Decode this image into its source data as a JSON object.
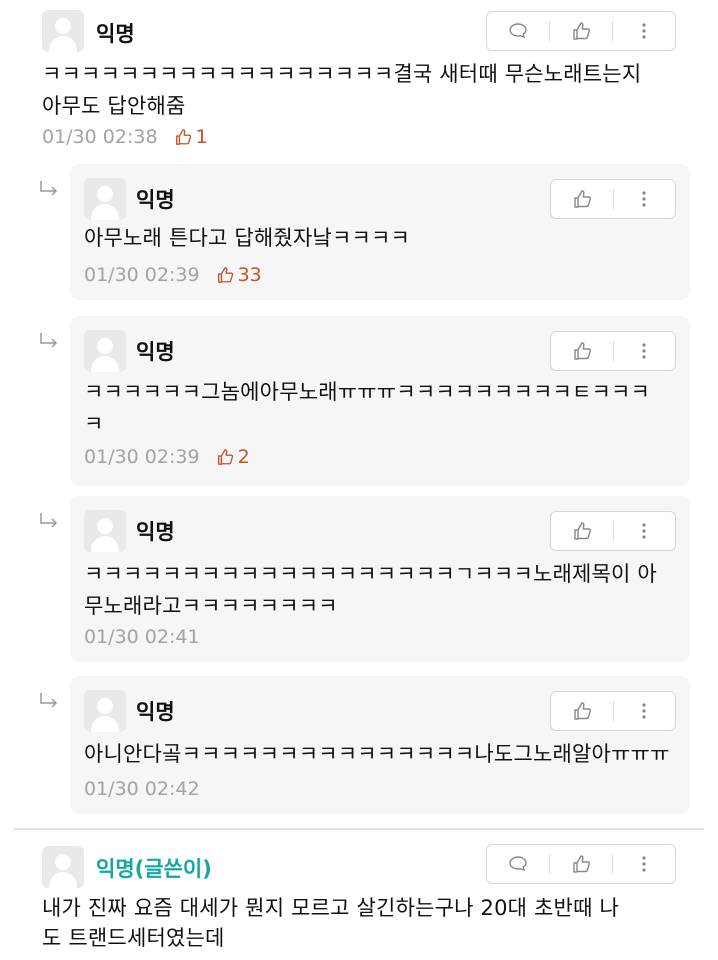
{
  "comments": [
    {
      "author": "익명",
      "text_lines": [
        "ㅋㅋㅋㅋㅋㅋㅋㅋㅋㅋㅋㅋㅋㅋㅋㅋㅋㅋ결국 새터때 무슨노래트는지",
        "아무도 답안해줌"
      ],
      "time": "01/30 02:38",
      "likes": "1"
    }
  ],
  "replies": [
    {
      "author": "익명",
      "text_lines": [
        "아무노래 튼다고 답해줬자낰ㅋㅋㅋㅋ"
      ],
      "time": "01/30 02:39",
      "likes": "33"
    },
    {
      "author": "익명",
      "text_lines": [
        "ㅋㅋㅋㅋㅋㅋ그놈에아무노래ㅠㅠㅠㅋㅋㅋㅋㅋㅋㅋㅋㅋㅌㅋㅋㅋ",
        "ㅋ"
      ],
      "time": "01/30 02:39",
      "likes": "2"
    },
    {
      "author": "익명",
      "text_lines": [
        "ㅋㅋㅋㅋㅋㅋㅋㅋㅋㅋㅋㅋㅋㅋㅋㅋㅋㅋㅋㄱㅋㅋㅋ노래제목이 아",
        "무노래라고ㅋㅋㅋㅋㅋㅋㅋㅋ"
      ],
      "time": "01/30 02:41",
      "likes": ""
    },
    {
      "author": "익명",
      "text_lines": [
        "아니안다곸ㅋㅋㅋㅋㅋㅋㅋㅋㅋㅋㅋㅋㅋㅋㅋ나도그노래알아ㅠㅠㅠ"
      ],
      "time": "01/30 02:42",
      "likes": ""
    }
  ],
  "last_comment": {
    "author": "익명(글쓴이)",
    "text_lines": [
      "내가 진짜 요즘 대세가 뭔지 모르고 살긴하는구나 20대 초반때 나",
      "도 트랜드세터였는데"
    ]
  },
  "icons": {
    "comment": "speech-bubble-icon",
    "like": "thumbs-up-icon",
    "more": "more-vertical-icon",
    "reply": "reply-arrow-icon",
    "avatar": "default-avatar"
  },
  "colors": {
    "like_accent": "#c8512a",
    "writer_name": "#15a6a6",
    "meta_gray": "#a3a3a6",
    "reply_bg": "#f6f6f7"
  }
}
